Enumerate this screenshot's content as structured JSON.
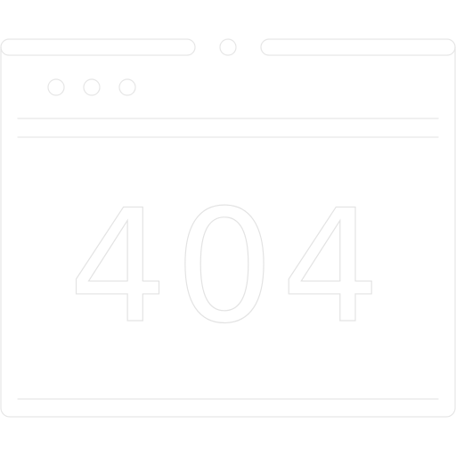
{
  "icon": {
    "name": "browser-404-icon",
    "error_code": "404",
    "stroke_color": "#e6e6e6",
    "background_color": "#ffffff"
  }
}
